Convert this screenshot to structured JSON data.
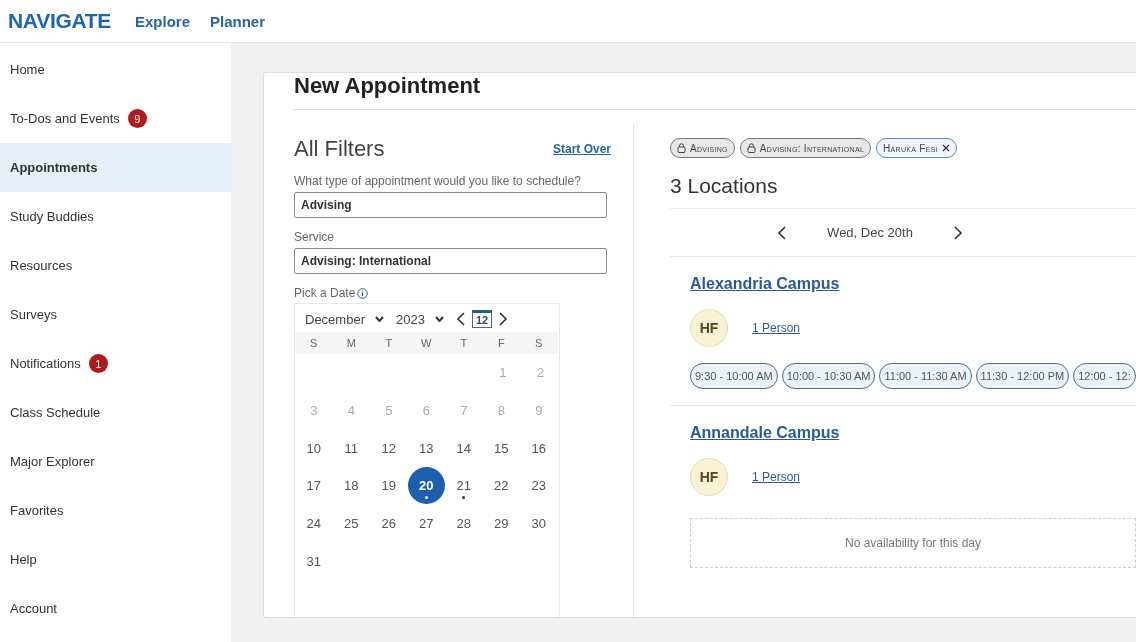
{
  "header": {
    "logo": "NAVIGATE",
    "links": [
      {
        "label": "Explore"
      },
      {
        "label": "Planner"
      }
    ]
  },
  "sidebar": {
    "items": [
      {
        "label": "Home",
        "selected": false
      },
      {
        "label": "To-Dos and Events",
        "badge": "9",
        "selected": false
      },
      {
        "label": "Appointments",
        "selected": true
      },
      {
        "label": "Study Buddies",
        "selected": false
      },
      {
        "label": "Resources",
        "selected": false
      },
      {
        "label": "Surveys",
        "selected": false
      },
      {
        "label": "Notifications",
        "badge": "1",
        "selected": false
      },
      {
        "label": "Class Schedule",
        "selected": false
      },
      {
        "label": "Major Explorer",
        "selected": false
      },
      {
        "label": "Favorites",
        "selected": false
      },
      {
        "label": "Help",
        "selected": false
      },
      {
        "label": "Account",
        "selected": false
      }
    ]
  },
  "page": {
    "title": "New Appointment"
  },
  "filters": {
    "title": "All Filters",
    "start_over": "Start Over",
    "type_label": "What type of appointment would you like to schedule?",
    "type_value": "Advising",
    "service_label": "Service",
    "service_value": "Advising: International",
    "date_label": "Pick a Date",
    "calendar": {
      "month": "December",
      "year": "2023",
      "today": "12",
      "weekdays": [
        "S",
        "M",
        "T",
        "W",
        "T",
        "F",
        "S"
      ],
      "weeks": [
        [
          {
            "day": "1",
            "disabled": true,
            "selected": false,
            "dot": false
          },
          {
            "day": "2",
            "disabled": true,
            "selected": false,
            "dot": false
          }
        ],
        [
          {
            "day": "3",
            "disabled": true,
            "selected": false,
            "dot": false
          },
          {
            "day": "4",
            "disabled": true,
            "selected": false,
            "dot": false
          },
          {
            "day": "5",
            "disabled": true,
            "selected": false,
            "dot": false
          },
          {
            "day": "6",
            "disabled": true,
            "selected": false,
            "dot": false
          },
          {
            "day": "7",
            "disabled": true,
            "selected": false,
            "dot": false
          },
          {
            "day": "8",
            "disabled": true,
            "selected": false,
            "dot": false
          },
          {
            "day": "9",
            "disabled": true,
            "selected": false,
            "dot": false
          }
        ],
        [
          {
            "day": "10",
            "disabled": false,
            "selected": false,
            "dot": false
          },
          {
            "day": "11",
            "disabled": false,
            "selected": false,
            "dot": false
          },
          {
            "day": "12",
            "disabled": false,
            "selected": false,
            "dot": false
          },
          {
            "day": "13",
            "disabled": false,
            "selected": false,
            "dot": false
          },
          {
            "day": "14",
            "disabled": false,
            "selected": false,
            "dot": false
          },
          {
            "day": "15",
            "disabled": false,
            "selected": false,
            "dot": false
          },
          {
            "day": "16",
            "disabled": false,
            "selected": false,
            "dot": false
          }
        ],
        [
          {
            "day": "17",
            "disabled": false,
            "selected": false,
            "dot": false
          },
          {
            "day": "18",
            "disabled": false,
            "selected": false,
            "dot": false
          },
          {
            "day": "19",
            "disabled": false,
            "selected": false,
            "dot": false
          },
          {
            "day": "20",
            "disabled": false,
            "selected": true,
            "dot": true
          },
          {
            "day": "21",
            "disabled": false,
            "selected": false,
            "dot": true
          },
          {
            "day": "22",
            "disabled": false,
            "selected": false,
            "dot": false
          },
          {
            "day": "23",
            "disabled": false,
            "selected": false,
            "dot": false
          }
        ],
        [
          {
            "day": "24",
            "disabled": false,
            "selected": false,
            "dot": false
          },
          {
            "day": "25",
            "disabled": false,
            "selected": false,
            "dot": false
          },
          {
            "day": "26",
            "disabled": false,
            "selected": false,
            "dot": false
          },
          {
            "day": "27",
            "disabled": false,
            "selected": false,
            "dot": false
          },
          {
            "day": "28",
            "disabled": false,
            "selected": false,
            "dot": false
          },
          {
            "day": "29",
            "disabled": false,
            "selected": false,
            "dot": false
          },
          {
            "day": "30",
            "disabled": false,
            "selected": false,
            "dot": false
          }
        ],
        [
          {
            "day": "31",
            "disabled": false,
            "selected": false,
            "dot": false
          }
        ]
      ]
    }
  },
  "results": {
    "chips": [
      {
        "label": "Advising",
        "kind": "locked"
      },
      {
        "label": "Advising: International",
        "kind": "locked"
      },
      {
        "label": "Haruka Fesi",
        "kind": "removable"
      }
    ],
    "title": "3 Locations",
    "date": "Wed, Dec 20th",
    "locations": [
      {
        "name": "Alexandria Campus",
        "initials": "HF",
        "people": "1 Person",
        "slots": [
          "9:30 - 10:00 AM",
          "10:00 - 10:30 AM",
          "11:00 - 11:30 AM",
          "11:30 - 12:00 PM",
          "12:00 - 12:"
        ]
      },
      {
        "name": "Annandale Campus",
        "initials": "HF",
        "people": "1 Person",
        "empty": "No availability for this day"
      }
    ]
  }
}
